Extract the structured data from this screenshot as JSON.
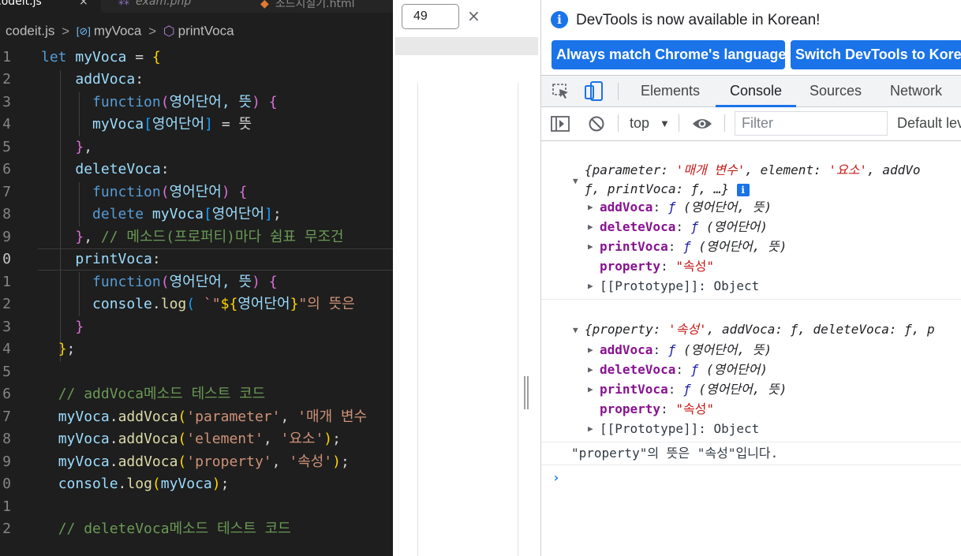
{
  "editor": {
    "tabs": [
      {
        "label": "codeit.js",
        "close": "×"
      },
      {
        "label": "exam.php",
        "icon": "php-icon"
      },
      {
        "label": "조드지칠기.html",
        "icon": "html-icon"
      }
    ],
    "breadcrumb": {
      "file": "codeit.js",
      "sep": ">",
      "object": "myVoca",
      "method": "printVoca"
    },
    "line_numbers": [
      "1",
      "2",
      "3",
      "4",
      "5",
      "6",
      "7",
      "8",
      "9",
      "0",
      "1",
      "2",
      "3",
      "4",
      "5",
      "6",
      "7",
      "8",
      "9",
      "0",
      "1",
      "2"
    ],
    "code": {
      "l1": {
        "kw": "let",
        "name": "myVoca",
        "eq": " = ",
        "brace": "{"
      },
      "l2": {
        "key": "addVoca",
        "colon": ":"
      },
      "l3": {
        "fn": "function",
        "open": "(",
        "args": "영어단어, 뜻",
        "close": ")",
        "brace": "{"
      },
      "l4": {
        "obj": "myVoca",
        "open": "[",
        "idx": "영어단어",
        "close": "]",
        "rest": " = 뜻"
      },
      "l5": {
        "brace": "}",
        "comma": ","
      },
      "l6": {
        "key": "deleteVoca",
        "colon": ":"
      },
      "l7": {
        "fn": "function",
        "open": "(",
        "args": "영어단어",
        "close": ")",
        "brace": "{"
      },
      "l8": {
        "kw": "delete",
        "obj": "myVoca",
        "open": "[",
        "idx": "영어단어",
        "close": "]",
        "semi": ";"
      },
      "l9": {
        "brace": "}",
        "comma": ", ",
        "comment": "// 메소드(프로퍼티)마다 쉼표 무조건"
      },
      "l10": {
        "key": "printVoca",
        "colon": ":"
      },
      "l11": {
        "fn": "function",
        "open": "(",
        "args": "영어단어, 뜻",
        "close": ")",
        "brace": "{"
      },
      "l12": {
        "obj": "console",
        "dot": ".",
        "method": "log",
        "open": "(",
        "tick": " `",
        "q1": "\"",
        "tpl_open": "${",
        "tpl_var": "영어단어",
        "tpl_close": "}",
        "q2": "\"",
        "rest": "의 뜻은"
      },
      "l13": {
        "brace": "}"
      },
      "l14": {
        "brace": "}",
        "semi": ";"
      },
      "l16": {
        "comment": "// addVoca메소드 테스트 코드"
      },
      "l17": {
        "obj": "myVoca",
        "dot": ".",
        "method": "addVoca",
        "open": "(",
        "a1": "'parameter'",
        "comma": ", ",
        "a2": "'매개 변수"
      },
      "l18": {
        "obj": "myVoca",
        "dot": ".",
        "method": "addVoca",
        "open": "(",
        "a1": "'element'",
        "comma": ", ",
        "a2": "'요소'",
        "close": ")",
        "semi": ";"
      },
      "l19": {
        "obj": "myVoca",
        "dot": ".",
        "method": "addVoca",
        "open": "(",
        "a1": "'property'",
        "comma": ", ",
        "a2": "'속성'",
        "close": ")",
        "semi": ";"
      },
      "l20": {
        "obj": "console",
        "dot": ".",
        "method": "log",
        "open": "(",
        "arg": "myVoca",
        "close": ")",
        "semi": ";"
      },
      "l22": {
        "comment": "// deleteVoca메소드 테스트 코드"
      }
    }
  },
  "browser": {
    "viewport_value": "49",
    "close": "×"
  },
  "devtools": {
    "banner": {
      "text": "DevTools is now available in Korean!",
      "btn_match": "Always match Chrome's language",
      "btn_switch": "Switch DevTools to Korean"
    },
    "tabs": [
      "Elements",
      "Console",
      "Sources",
      "Network"
    ],
    "active_tab": "Console",
    "toolbar": {
      "context": "top",
      "filter_placeholder": "Filter",
      "levels": "Default levels"
    },
    "log1": {
      "summary_a": "{parameter: ",
      "summary_a_val": "'매개 변수'",
      "summary_b": ", element: ",
      "summary_b_val": "'요소'",
      "summary_c": ", addVo",
      "summary_line2": "ƒ, printVoca: ƒ, …}",
      "info": "i",
      "props": [
        {
          "name": "addVoca",
          "sym": "ƒ",
          "args": " (영어단어, 뜻)"
        },
        {
          "name": "deleteVoca",
          "sym": "ƒ",
          "args": " (영어단어)"
        },
        {
          "name": "printVoca",
          "sym": "ƒ",
          "args": " (영어단어, 뜻)"
        }
      ],
      "property_key": "property",
      "property_val": "\"속성\"",
      "proto_key": "[[Prototype]]",
      "proto_val": "Object"
    },
    "log2": {
      "summary_a": "{property: ",
      "summary_a_val": "'속성'",
      "summary_b": ", addVoca: ƒ, deleteVoca: ƒ, p",
      "props": [
        {
          "name": "addVoca",
          "sym": "ƒ",
          "args": " (영어단어, 뜻)"
        },
        {
          "name": "deleteVoca",
          "sym": "ƒ",
          "args": " (영어단어)"
        },
        {
          "name": "printVoca",
          "sym": "ƒ",
          "args": " (영어단어, 뜻)"
        }
      ],
      "property_key": "property",
      "property_val": "\"속성\"",
      "proto_key": "[[Prototype]]",
      "proto_val": "Object"
    },
    "log3": "\"property\"의 뜻은 \"속성\"입니다.",
    "prompt": "›"
  },
  "colors": {
    "accent": "#1a73e8",
    "editor_bg": "#1e1e1e"
  }
}
